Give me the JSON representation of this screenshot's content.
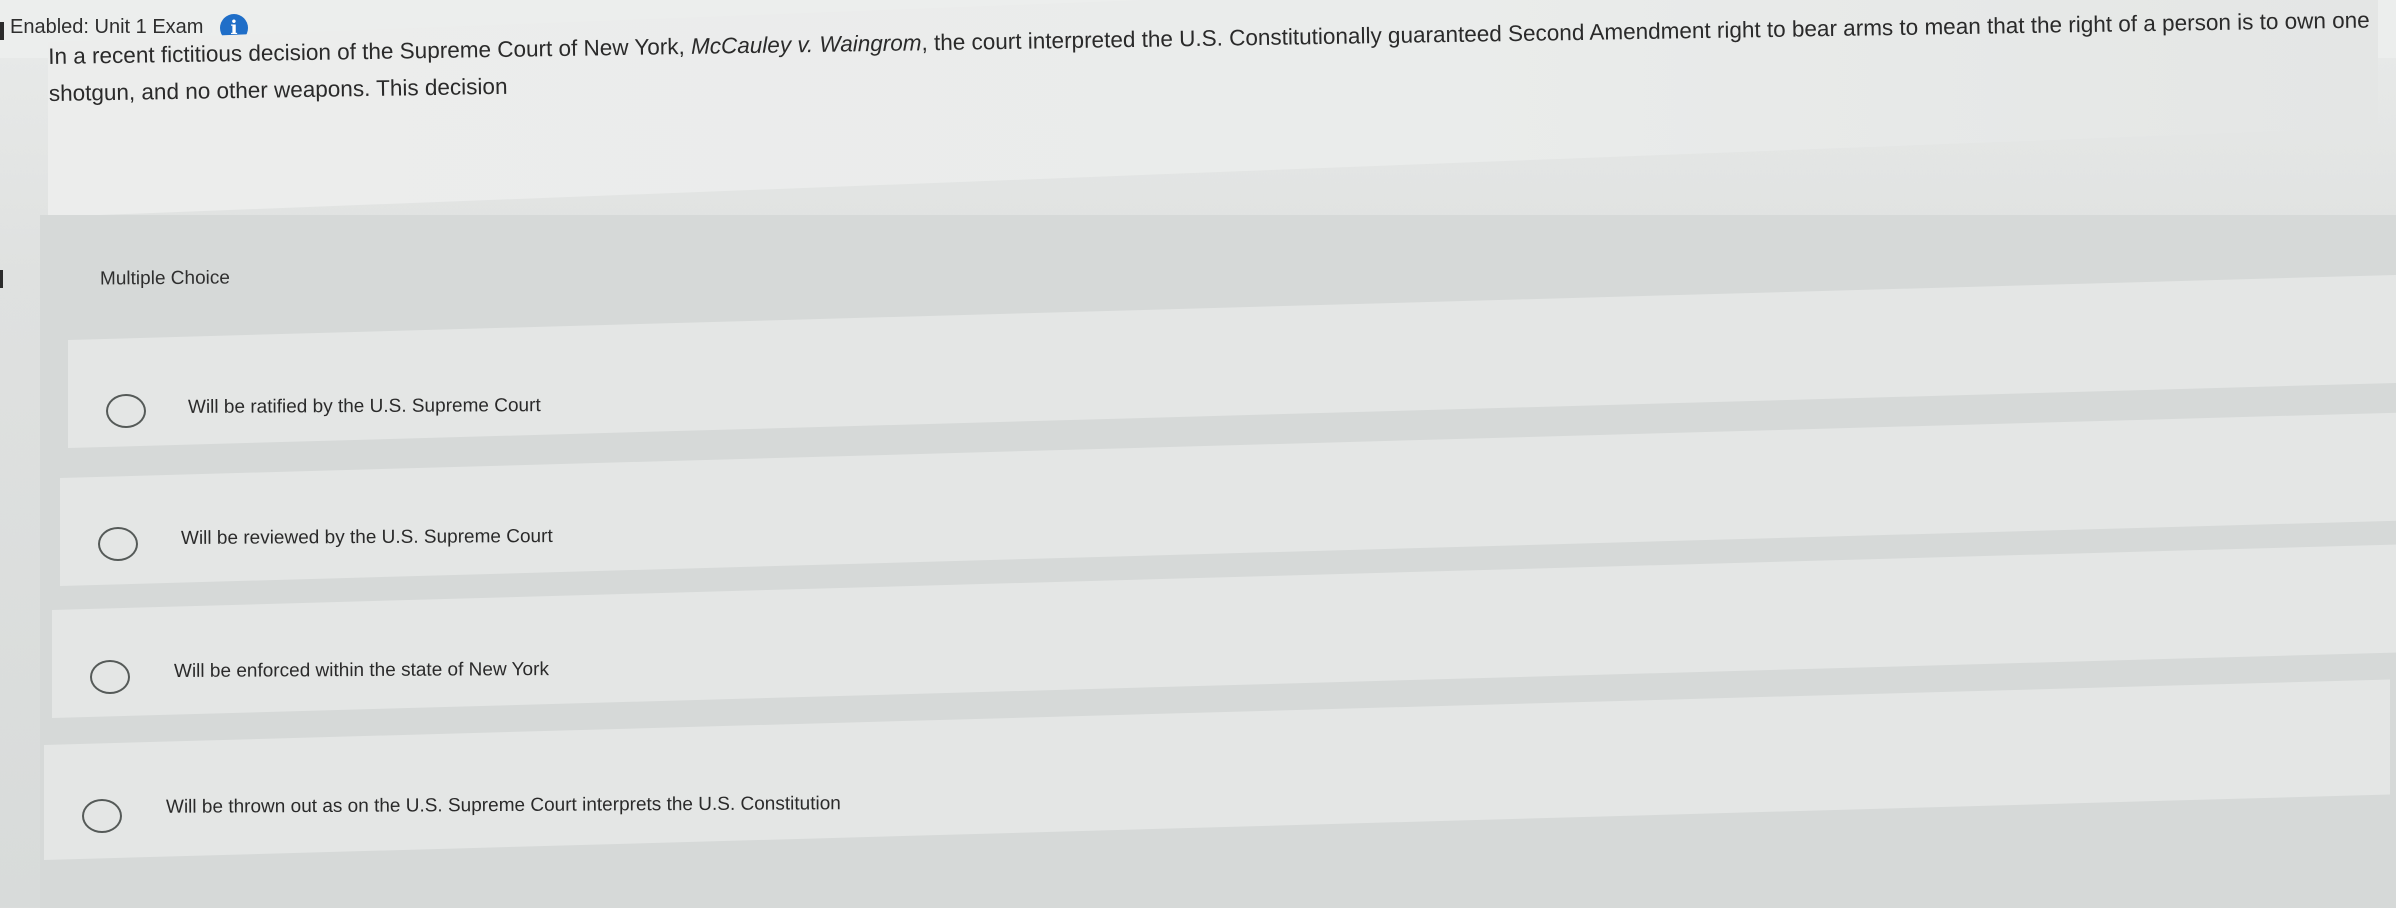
{
  "header": {
    "title": "Enabled: Unit 1 Exam",
    "info_icon": "info-icon",
    "info_glyph": "i"
  },
  "question": {
    "text_before": "In a recent fictitious decision of the Supreme Court of New York, ",
    "case_name": "McCauley v. Waingrom",
    "text_after": ", the court interpreted the U.S. Constitutionally guaranteed Second Amendment right to bear arms to mean that the right of a person is to own one shotgun, and no other weapons. This decision"
  },
  "answers": {
    "type_label": "Multiple Choice",
    "options": [
      {
        "label": "Will be ratified by the U.S. Supreme Court",
        "selected": false
      },
      {
        "label": "Will be reviewed by the U.S. Supreme Court",
        "selected": false
      },
      {
        "label": "Will be enforced within the state of New York",
        "selected": false
      },
      {
        "label": "Will be thrown out as on the U.S. Supreme Court interprets the U.S. Constitution",
        "selected": false
      }
    ]
  },
  "colors": {
    "info_icon_bg": "#1f6ec8",
    "text": "#2a2a2a",
    "radio_border": "#555a58"
  }
}
